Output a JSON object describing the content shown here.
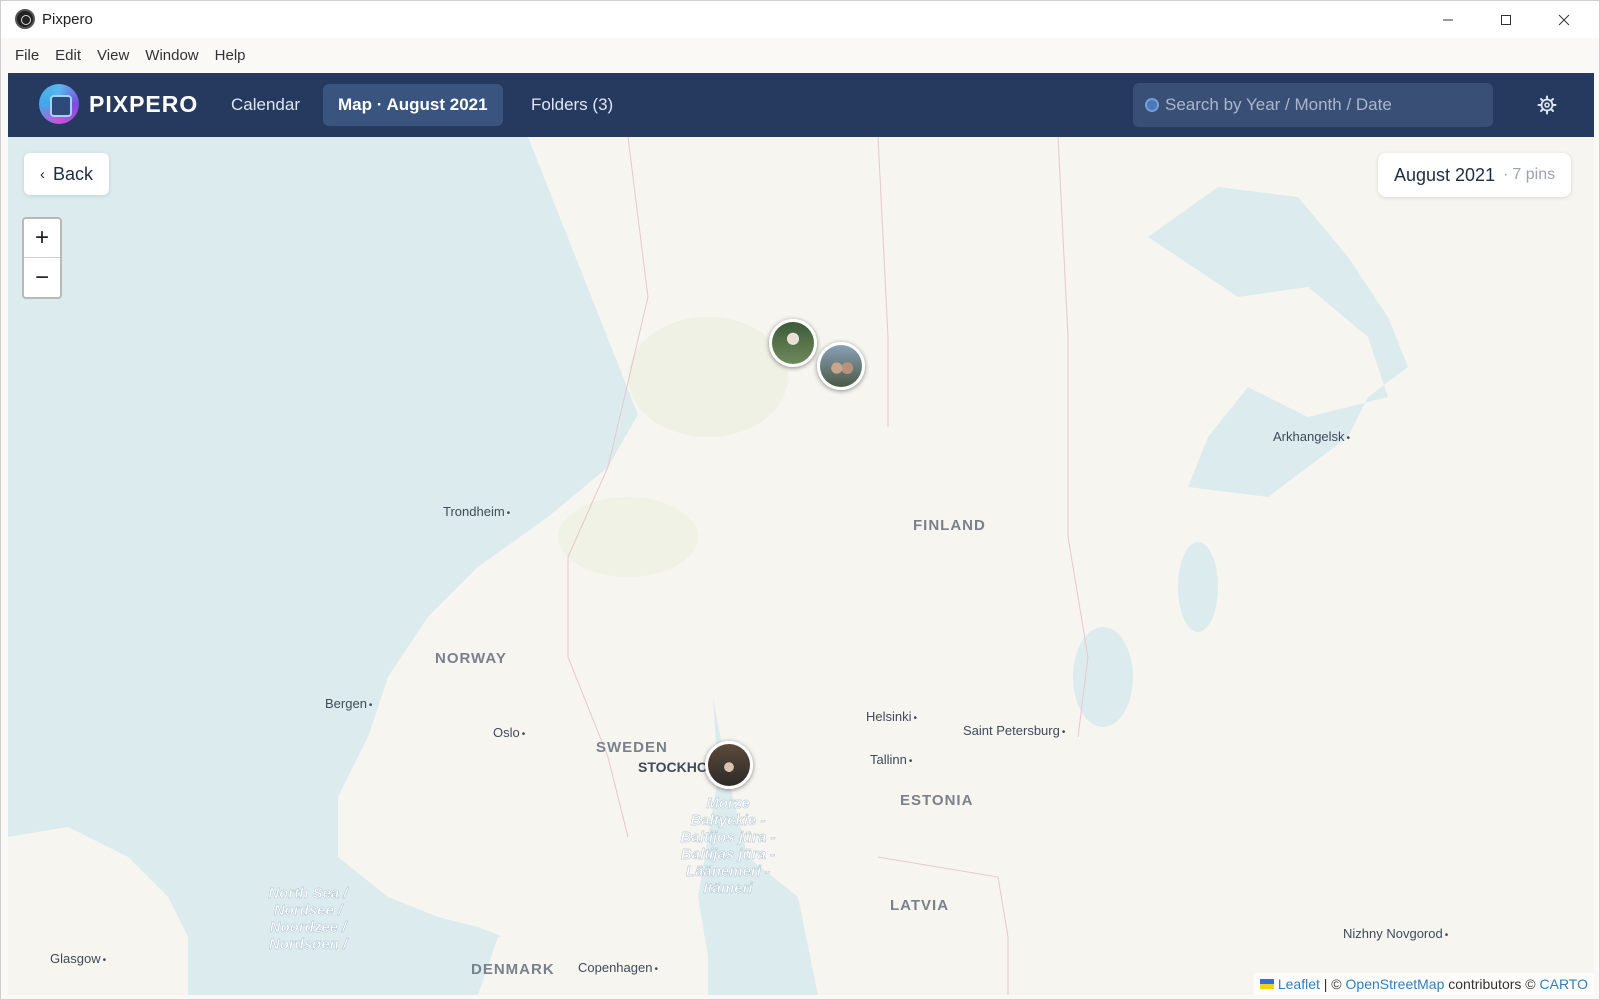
{
  "window": {
    "title": "Pixpero"
  },
  "menu": [
    "File",
    "Edit",
    "View",
    "Window",
    "Help"
  ],
  "header": {
    "logo_text": "PIXPERO",
    "tabs": [
      {
        "label": "Calendar",
        "active": false
      },
      {
        "label": "Map · August 2021",
        "active": true
      },
      {
        "label": "Folders (3)",
        "active": false
      }
    ],
    "search_placeholder": "Search by Year / Month / Date",
    "settings_icon": "gear-icon"
  },
  "map": {
    "back_label": "Back",
    "zoom_in": "+",
    "zoom_out": "−",
    "info": {
      "month": "August 2021",
      "pins": "7 pins"
    },
    "labels": {
      "finland": "FINLAND",
      "norway": "NORWAY",
      "sweden": "SWEDEN",
      "estonia": "ESTONIA",
      "latvia": "LATVIA",
      "denmark": "DENMARK",
      "trondheim": "Trondheim",
      "bergen": "Bergen",
      "oslo": "Oslo",
      "stockholm": "STOCKHO",
      "helsinki": "Helsinki",
      "tallinn": "Tallinn",
      "saint_petersburg": "Saint Petersburg",
      "arkhangelsk": "Arkhangelsk",
      "nizhny_novgorod": "Nizhny Novgorod",
      "glasgow": "Glasgow",
      "copenhagen": "Copenhagen",
      "baltic_sea": "Morze Bałtyckie - Baltijos jūra - Baltijas jūra - Läänemeri - Itämeri",
      "north_sea": "North Sea / Nordsee / Noordzee / Nordsøen /"
    },
    "pins": [
      {
        "name": "photo-pin-north-1"
      },
      {
        "name": "photo-pin-north-2"
      },
      {
        "name": "photo-pin-stockholm"
      }
    ]
  },
  "attribution": {
    "leaflet": "Leaflet",
    "sep": "| ©",
    "osm": "OpenStreetMap",
    "contributors": "contributors ©",
    "carto": "CARTO"
  },
  "colors": {
    "header_bg": "#253a5e",
    "active_tab_bg": "#3a5480",
    "water": "#dcecee",
    "land": "#f7f5f0"
  }
}
